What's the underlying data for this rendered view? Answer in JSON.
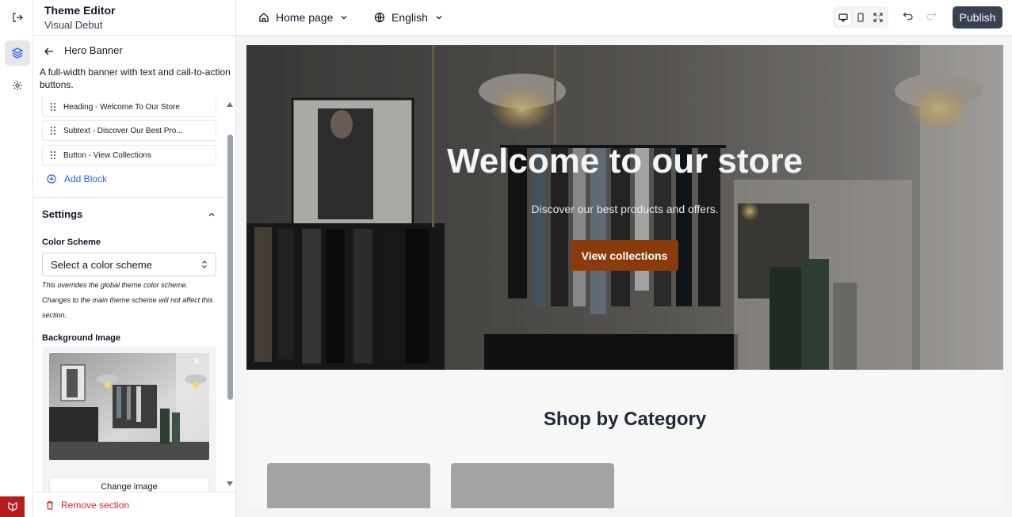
{
  "app": {
    "title": "Theme Editor",
    "subtitle": "Visual Debut"
  },
  "toolbar": {
    "page_select": "Home page",
    "language_select": "English",
    "publish_label": "Publish"
  },
  "panel": {
    "title": "Hero Banner",
    "description": "A full-width banner with text and call-to-action buttons.",
    "blocks": [
      {
        "label": "Heading - Welcome To Our Store"
      },
      {
        "label": "Subtext - Discover Our Best Pro..."
      },
      {
        "label": "Button - View Collections"
      }
    ],
    "add_block_label": "Add Block",
    "settings_title": "Settings",
    "color_scheme_label": "Color Scheme",
    "color_scheme_value": "Select a color scheme",
    "color_scheme_hint": "This overrides the global theme color scheme. Changes to the main theme scheme will not affect this section.",
    "background_image_label": "Background Image",
    "change_image_label": "Change image",
    "remove_section_label": "Remove section"
  },
  "preview": {
    "hero_title": "Welcome to our store",
    "hero_subtitle": "Discover our best products and offers.",
    "hero_button": "View collections",
    "category_title": "Shop by Category"
  },
  "colors": {
    "accent": "#2563eb",
    "publish_bg": "#374151",
    "hero_button_bg": "#8a3b0c",
    "danger": "#dc2626"
  }
}
